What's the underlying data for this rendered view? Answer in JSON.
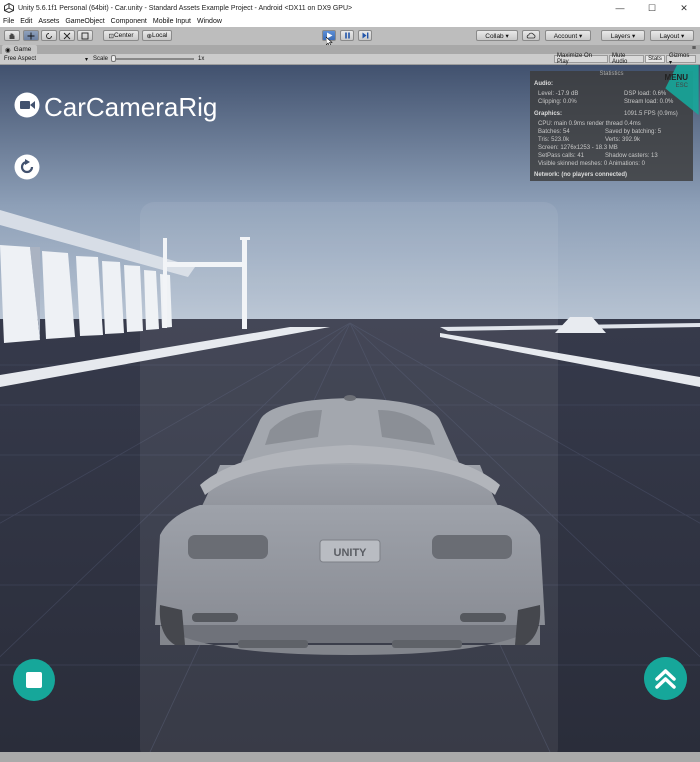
{
  "window": {
    "title": "Unity 5.6.1f1 Personal (64bit) - Car.unity - Standard Assets Example Project - Android <DX11 on DX9 GPU>",
    "controls": [
      "—",
      "☐",
      "✕"
    ]
  },
  "menubar": [
    "File",
    "Edit",
    "Assets",
    "GameObject",
    "Component",
    "Mobile Input",
    "Window"
  ],
  "toolbar": {
    "pivot_label": "Center",
    "space_label": "Local",
    "collab_label": "Collab ▾",
    "account_label": "Account ▾",
    "layers_label": "Layers ▾",
    "layout_label": "Layout ▾"
  },
  "game_tab": {
    "label": "Game",
    "aspect": "Free Aspect",
    "scale_label": "Scale",
    "scale_value": "1x",
    "maximize_label": "Maximize On Play",
    "mute_label": "Mute Audio",
    "stats_label": "Stats",
    "gizmos_label": "Gizmos ▾"
  },
  "hud": {
    "camera_rig_label": "CarCameraRig",
    "menu_label": "MENU",
    "esc_label": "ESC"
  },
  "stats_panel": {
    "header": "Statistics",
    "audio_title": "Audio:",
    "level": "Level: -17.9 dB",
    "clipping": "Clipping: 0.0%",
    "dsp_load": "DSP load: 0.6%",
    "stream_load": "Stream load: 0.0%",
    "graphics_title": "Graphics:",
    "fps": "1091.5 FPS (0.9ms)",
    "cpu": "CPU: main 0.9ms  render thread 0.4ms",
    "batches": "Batches: 54",
    "saved_batching": "Saved by batching: 5",
    "tris": "Tris: 523.0k",
    "verts": "Verts: 392.9k",
    "screen": "Screen: 1276x1253 - 18.3 MB",
    "setpass": "SetPass calls: 41",
    "shadow_casters": "Shadow casters: 13",
    "skinned": "Visible skinned meshes: 0  Animations: 0",
    "network": "Network: (no players connected)"
  },
  "car": {
    "plate_text": "UNITY"
  },
  "colors": {
    "accent_teal": "#16a79a",
    "sky_top": "#41516e",
    "sky_horizon": "#aab9cd",
    "ground": "#2f3240"
  }
}
